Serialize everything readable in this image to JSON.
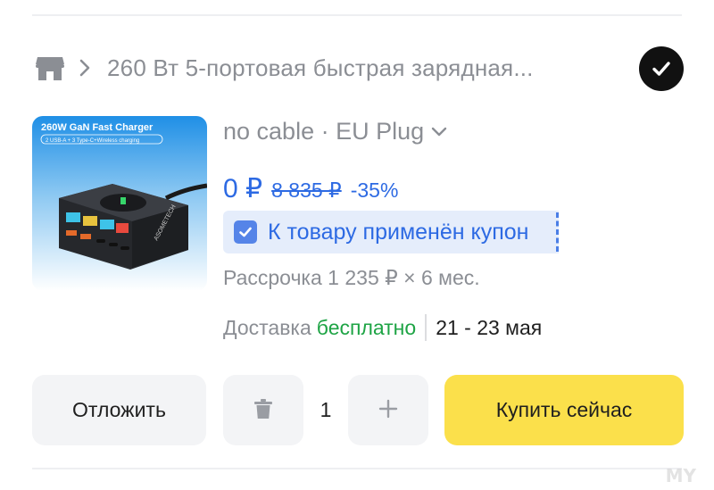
{
  "store": {
    "icon": "store-icon",
    "title": "260 Вт 5-портовая быстрая зарядная...",
    "selected_icon": "check-icon"
  },
  "product": {
    "image": {
      "banner_title": "260W GaN Fast Charger",
      "banner_subtitle": "2 USB-A + 3 Type-C+Wireless charging",
      "brand": "ASOMETECH"
    },
    "variant": "no cable · EU Plug",
    "price": {
      "current": "0 ₽",
      "old": "8 835 ₽",
      "discount": "-35%"
    },
    "coupon": "К товару применён купон",
    "installment": "Рассрочка 1 235 ₽ × 6 мес.",
    "delivery": {
      "label": "Доставка",
      "cost": "бесплатно",
      "dates": "21 - 23 мая"
    }
  },
  "actions": {
    "later": "Отложить",
    "quantity": "1",
    "buy": "Купить сейчас"
  },
  "colors": {
    "accent_blue": "#2d6ae3",
    "coupon_bg": "#e5edfb",
    "free_green": "#1ea445",
    "buy_yellow": "#fbe04b",
    "muted_text": "#8b8e94"
  },
  "watermark": "MY"
}
